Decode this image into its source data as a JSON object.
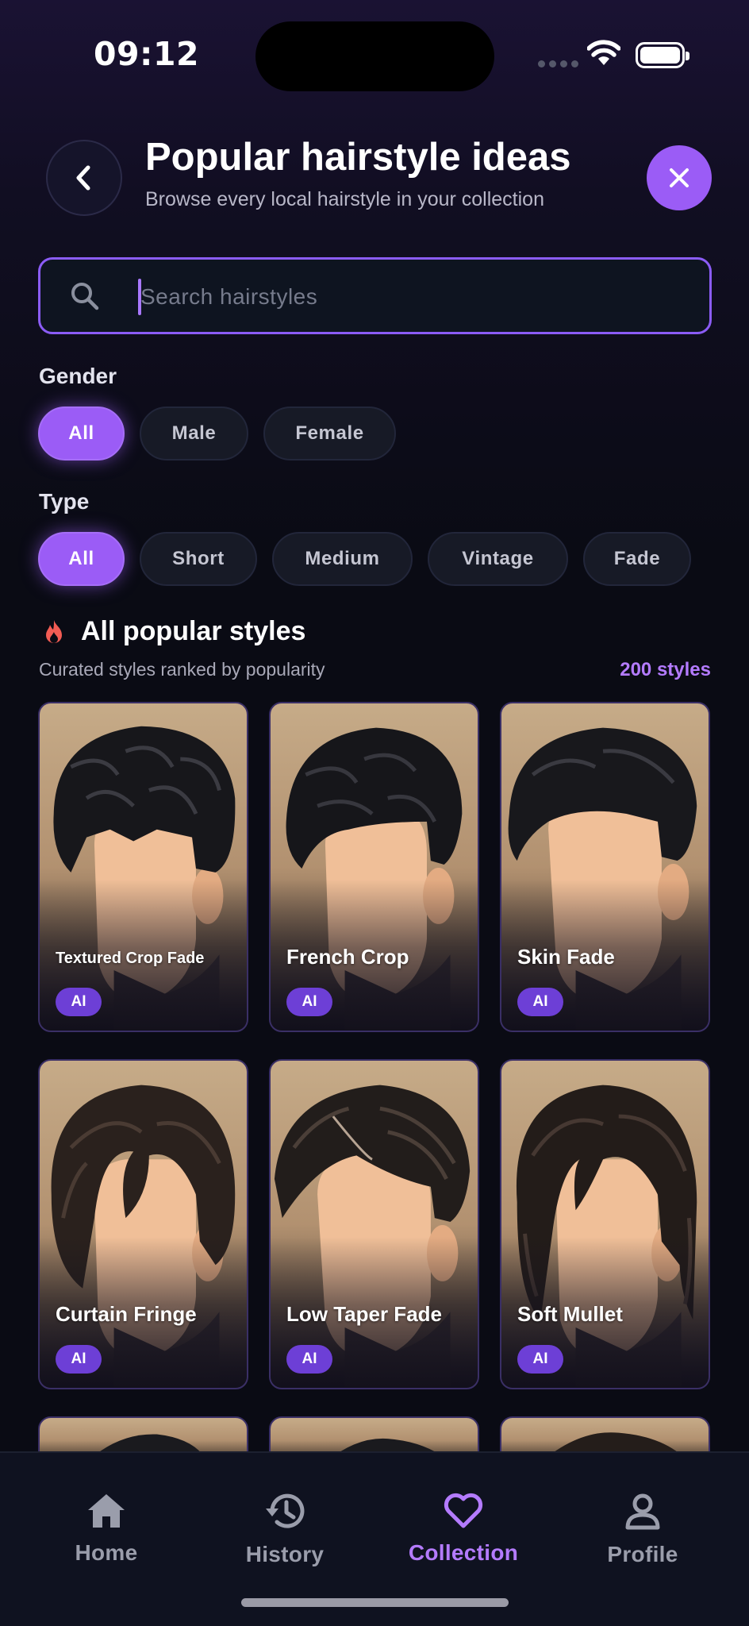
{
  "status_bar": {
    "time": "09:12"
  },
  "header": {
    "title": "Popular hairstyle ideas",
    "subtitle": "Browse every local hairstyle in your collection",
    "back_icon": "chevron-left-icon",
    "close_icon": "close-icon"
  },
  "search": {
    "placeholder": "Search hairstyles",
    "value": ""
  },
  "filters": {
    "gender": {
      "label": "Gender",
      "options": [
        "All",
        "Male",
        "Female"
      ],
      "selected": "All"
    },
    "type": {
      "label": "Type",
      "options": [
        "All",
        "Short",
        "Medium",
        "Vintage",
        "Fade"
      ],
      "selected": "All"
    }
  },
  "popular": {
    "title": "All popular styles",
    "subtitle": "Curated styles ranked by popularity",
    "count": "200 styles",
    "items": [
      {
        "name": "Textured Crop Fade",
        "badge": "AI"
      },
      {
        "name": "French Crop",
        "badge": "AI"
      },
      {
        "name": "Skin Fade",
        "badge": "AI"
      },
      {
        "name": "Curtain Fringe",
        "badge": "AI"
      },
      {
        "name": "Low Taper Fade",
        "badge": "AI"
      },
      {
        "name": "Soft Mullet",
        "badge": "AI"
      }
    ]
  },
  "bottom_nav": {
    "items": [
      {
        "label": "Home",
        "icon": "home-icon"
      },
      {
        "label": "History",
        "icon": "history-icon"
      },
      {
        "label": "Collection",
        "icon": "heart-icon"
      },
      {
        "label": "Profile",
        "icon": "profile-icon"
      }
    ],
    "active": "Collection"
  },
  "colors": {
    "accent": "#9b5cf6",
    "accent_text": "#b47bff",
    "background": "#0a0b14"
  }
}
